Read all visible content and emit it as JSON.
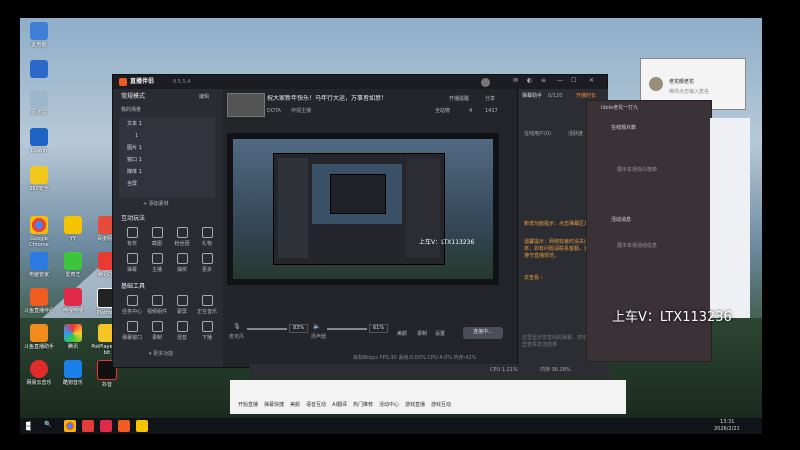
{
  "desktop": {
    "icons_col1": [
      "此电脑",
      "",
      "回收站",
      "DoWin",
      "360安全",
      "Google Chrome",
      "电脑管家",
      "斗鱼直播伴侣",
      "斗鱼直播助手",
      "网易云音乐"
    ],
    "icons_col2": [
      "微信",
      "",
      "",
      "",
      "",
      "",
      "",
      "",
      "",
      ""
    ],
    "icons_col3": [
      "酷狗K",
      "",
      "",
      "",
      "",
      "",
      "",
      "",
      "",
      ""
    ],
    "icons_bottom": [
      "Google Chrome",
      "YY",
      "百度网盘",
      "电脑管家",
      "爱奇艺",
      "哔哩哔哩",
      "斗鱼直播伴侣",
      "腾讯QQ",
      "Platform",
      "斗鱼直播助手",
      "腾讯",
      "PotPlayer 64 bit",
      "网易云音乐",
      "酷狗音乐",
      "抖音"
    ]
  },
  "app": {
    "title": "直播伴侣",
    "version": "8.5.5.4",
    "scene_header": "常规模式",
    "scene_tab1": "我的场景",
    "scene_tab2": "编辑",
    "scene_list": [
      "文本 1",
      "1",
      "图片 1",
      "窗口 1",
      "媒体 1",
      "全屏"
    ],
    "add_source": "+ 添加素材",
    "interact_title": "互动玩法",
    "interact_items": [
      "有奖",
      "截图",
      "粉丝团",
      "礼物",
      "弹幕",
      "主播",
      "抽奖",
      "更多"
    ],
    "tools_title": "基础工具",
    "tools_items": [
      "任务中心",
      "视频组件",
      "蒙屏",
      "正在音乐",
      "弹幕窗口",
      "录制",
      "混音",
      "下播"
    ],
    "more_func": "▾ 更多功能",
    "stream_title": "祝大家新年快乐！马年行大运，万事皆如意！",
    "stream_category": "DOTA",
    "stream_sub": "伴视主播",
    "open_live": "开播提醒",
    "share": "分享",
    "stat_full": "全站榜",
    "stat_count": "4",
    "stat_fans": "1417",
    "mic_label": "麦克风",
    "mic_pct": "83%",
    "speaker_label": "扬声器",
    "speaker_pct": "61%",
    "effect": "美颜",
    "record": "录制",
    "settings": "设置",
    "go_live": "连接中...",
    "status_bar": "目标8kbps  FPS:30  丢帧:0.00%  CPU:4.0%  内存:42%",
    "chat_tabs": [
      "弹幕助手",
      "在线用户(0)",
      "活跃度",
      "贡献"
    ],
    "chat_hint_tab": "开播时长",
    "chat_count": "0/120",
    "chat_sys1": "新增功能提示：点击弹幕区发送消息",
    "chat_sys2": "温馨提示：网络较差时请关闭高码率；如有问题请联系客服。直播中请遵守直播规范。",
    "chat_more": "去查看 ›",
    "chat_input": "这里显示您发出的弹幕，您可以在这里查看发送结果",
    "cpu_label": "CPU 1.21%",
    "mem_label": "内存 36.28%"
  },
  "overlay_text": "上车V：LTX113236",
  "inner_overlay": "上车V：LTX113236",
  "right_panel": {
    "title": "老花眼老花",
    "subtitle": "等你点击输入签名",
    "tab1": "主播",
    "online": "在线观众数",
    "hint": "展示本场观众榜单",
    "section2": "活动消息",
    "hint2": "展示本场活动信息",
    "window_label": "Idole老花一打九"
  },
  "taskbar": {
    "search": "🔍",
    "time": "13:31",
    "date": "2026/2/21"
  },
  "bottom_toolbar": {
    "items": [
      "开始直播",
      "弹幕快捷",
      "美颜",
      "语音互动",
      "AI翻译",
      "热门推荐",
      "活动中心",
      "游戏直播",
      "游戏互动"
    ]
  }
}
